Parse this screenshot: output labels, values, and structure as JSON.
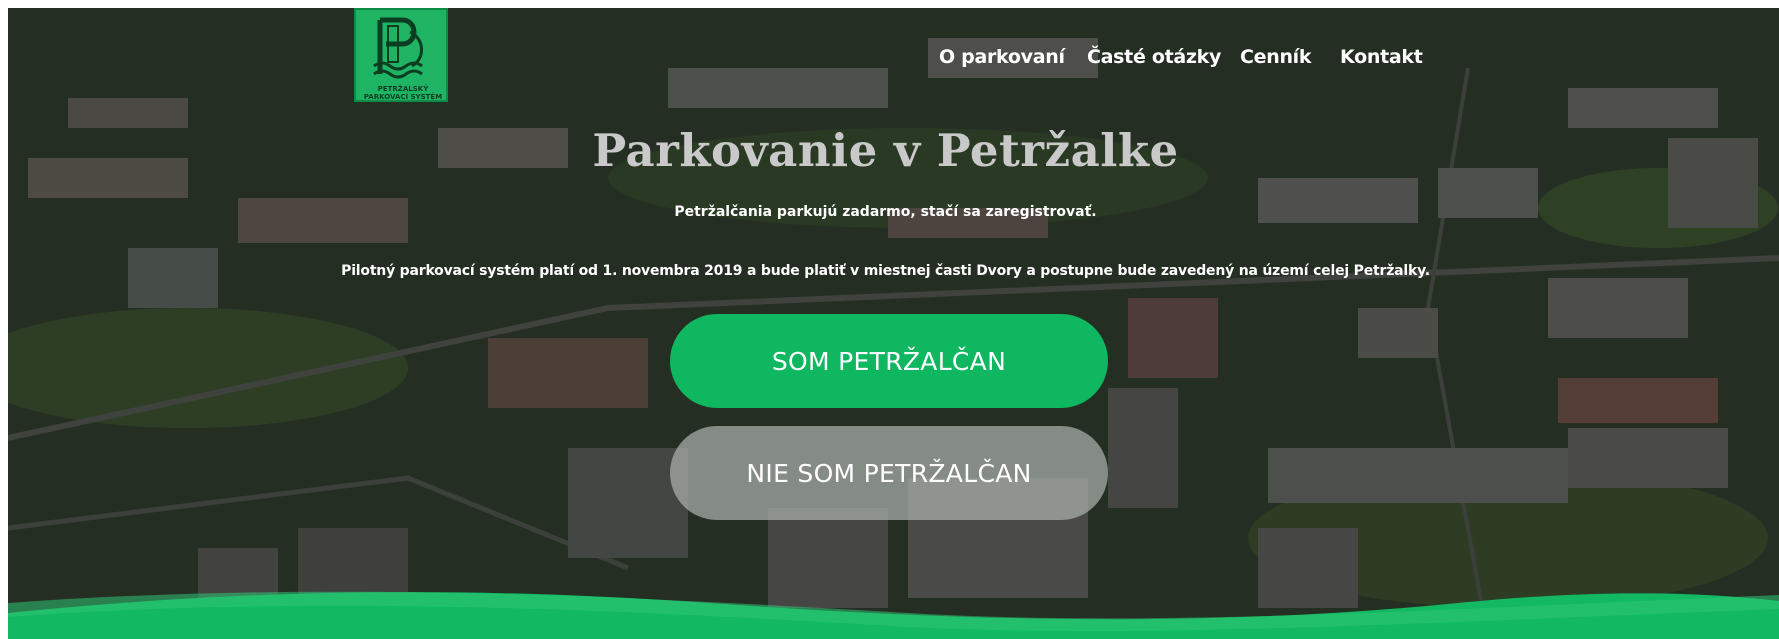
{
  "brand": {
    "logo_line1": "PETRŽALSKÝ",
    "logo_line2": "PARKOVACÍ SYSTÉM",
    "logo_color": "#1fb463"
  },
  "nav": {
    "items": [
      {
        "label": "O parkovaní"
      },
      {
        "label": "Časté otázky"
      },
      {
        "label": "Cenník"
      },
      {
        "label": "Kontakt"
      }
    ]
  },
  "hero": {
    "title": "Parkovanie v Petržalke",
    "subtitle": "Petržalčania parkujú zadarmo, stačí sa zaregistrovať.",
    "info": "Pilotný parkovací systém platí od 1. novembra 2019 a bude platiť v miestnej časti Dvory a postupne bude zavedený na území celej Petržalky.",
    "primary_button": "SOM PETRŽALČAN",
    "secondary_button": "NIE SOM PETRŽALČAN"
  },
  "colors": {
    "accent": "#0fb760",
    "wave": "#12b862",
    "secondary_button": "#aab0ac"
  }
}
